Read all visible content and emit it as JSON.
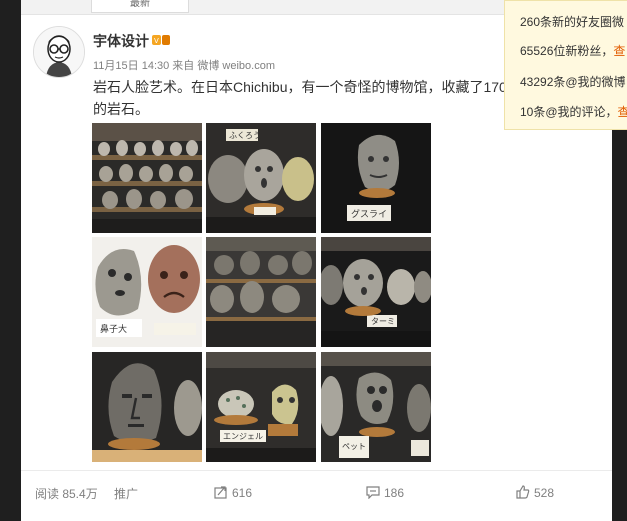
{
  "tabs": {
    "active_label": "最新"
  },
  "post": {
    "username": "宇体设计",
    "verified_icon": "vip-badge-icon",
    "meta": "11月15日 14:30 来自 微博 weibo.com",
    "text_line1": "岩石人脸艺术。在日本Chichibu，有一个奇怪的博物馆，收藏了170",
    "text_line2": "的岩石。",
    "photo_labels": {
      "p2": "ふくろう",
      "p3": "グスライ",
      "p4": "鼻子大",
      "p6": "ターミ",
      "p8": "エンジェル",
      "p9": "ペット"
    }
  },
  "actions": {
    "views": "阅读 85.4万",
    "promote": "推广",
    "repost_icon": "repost-icon",
    "repost_count": "616",
    "comment_icon": "comment-icon",
    "comment_count": "186",
    "like_icon": "thumbs-up-icon",
    "like_count": "528"
  },
  "notifications": [
    {
      "count": "260",
      "text": "条新的好友圈微",
      "link": ""
    },
    {
      "count": "65526",
      "text": "位新粉丝，",
      "link": "查"
    },
    {
      "count": "43292",
      "text": "条@我的微博",
      "link": ""
    },
    {
      "count": "10",
      "text": "条@我的评论，",
      "link": "查"
    }
  ],
  "colors": {
    "accent_orange": "#e25c00",
    "page_background": "#1f1f1f",
    "card_background": "#ffffff",
    "notice_background": "#fff9df"
  }
}
